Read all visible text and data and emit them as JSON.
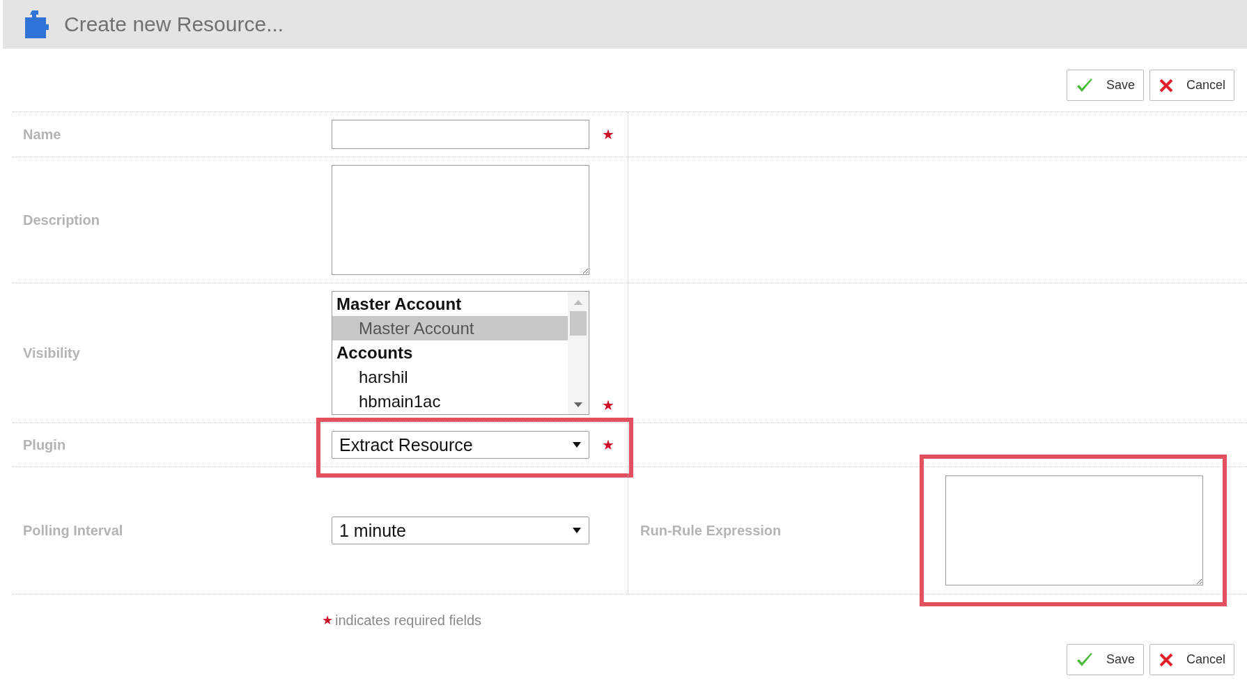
{
  "header": {
    "title": "Create new Resource..."
  },
  "top_buttons": [
    {
      "kind": "save",
      "label": "Save"
    },
    {
      "kind": "cancel",
      "label": "Cancel"
    }
  ],
  "rows": [
    {
      "kind": "text",
      "label": "Name",
      "required_mark": "★",
      "highlighted": false
    },
    {
      "kind": "textarea",
      "label": "Description",
      "highlighted": false
    },
    {
      "kind": "listbox",
      "label": "Visibility",
      "required_mark": "★",
      "highlighted": false,
      "items": [
        {
          "kind": "group",
          "label": "Master Account",
          "selected": false
        },
        {
          "kind": "option",
          "label": "Master Account",
          "selected": true
        },
        {
          "kind": "group",
          "label": "Accounts",
          "selected": false
        },
        {
          "kind": "option",
          "label": "harshil",
          "selected": false
        },
        {
          "kind": "option",
          "label": "hbmain1ac",
          "selected": false
        }
      ]
    },
    {
      "kind": "select",
      "label": "Plugin",
      "value": "Extract Resource",
      "required_mark": "★",
      "highlighted": true
    },
    {
      "kind": "select",
      "label": "Polling Interval",
      "value": "1 minute",
      "highlighted": false,
      "side": {
        "label": "Run-Rule Expression",
        "highlighted": true
      }
    }
  ],
  "footer_note": {
    "mark": "★",
    "text": "indicates required fields"
  },
  "bottom_buttons": [
    {
      "kind": "save",
      "label": "Save"
    },
    {
      "kind": "cancel",
      "label": "Cancel"
    }
  ]
}
